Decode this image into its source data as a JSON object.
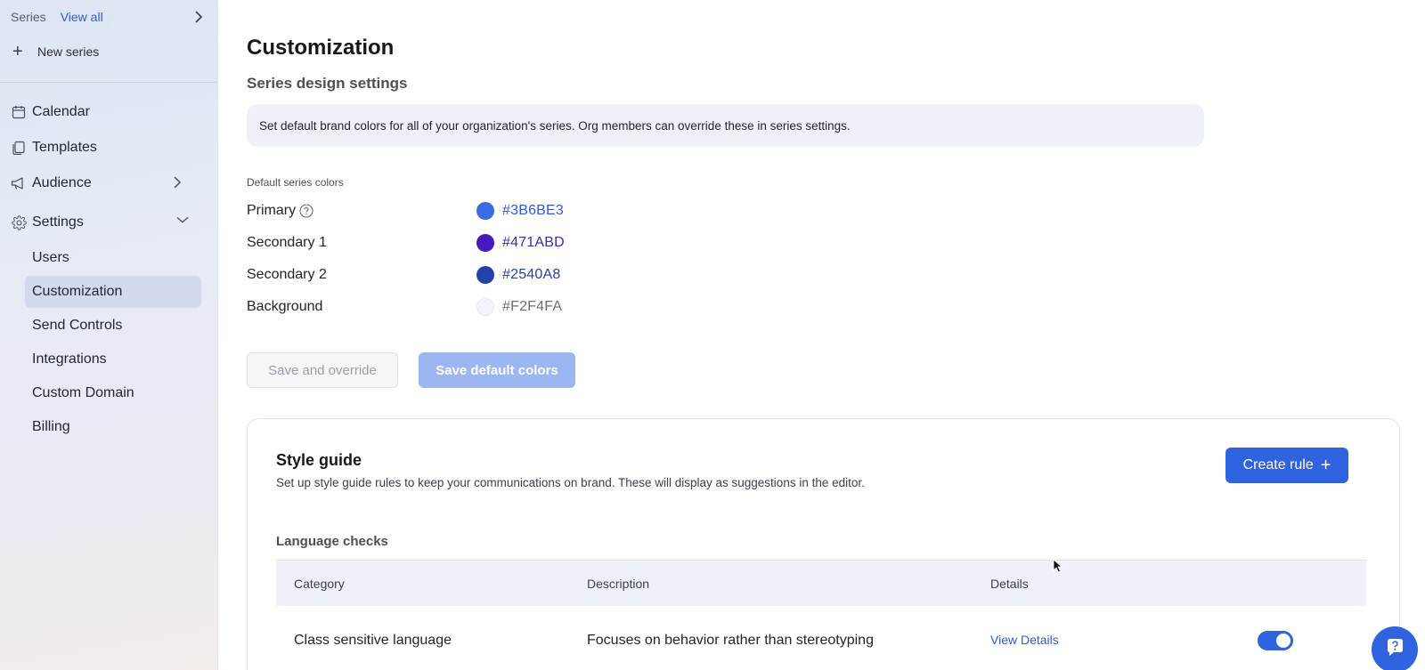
{
  "sidebar": {
    "series_label": "Series",
    "view_all": "View all",
    "new_series": "New series",
    "nav": [
      {
        "label": "Calendar",
        "icon": "calendar-icon"
      },
      {
        "label": "Templates",
        "icon": "templates-icon"
      },
      {
        "label": "Audience",
        "icon": "megaphone-icon"
      },
      {
        "label": "Settings",
        "icon": "gear-icon"
      }
    ],
    "settings_items": [
      {
        "label": "Users"
      },
      {
        "label": "Customization",
        "active": true
      },
      {
        "label": "Send Controls"
      },
      {
        "label": "Integrations"
      },
      {
        "label": "Custom Domain"
      },
      {
        "label": "Billing"
      }
    ]
  },
  "main": {
    "title": "Customization",
    "section_title": "Series design settings",
    "info_text": "Set default brand colors for all of your organization's series. Org members can override these in series settings.",
    "colors_label": "Default series colors",
    "colors": [
      {
        "name": "Primary",
        "hex": "#3B6BE3",
        "swatch": "#3B6BE3",
        "text_color": "#2e5ad8"
      },
      {
        "name": "Secondary 1",
        "hex": "#471ABD",
        "swatch": "#471ABD",
        "text_color": "#3a2db0"
      },
      {
        "name": "Secondary 2",
        "hex": "#2540A8",
        "swatch": "#2540A8",
        "text_color": "#2540A8"
      },
      {
        "name": "Background",
        "hex": "#F2F4FA",
        "swatch": "#F2F4FA",
        "text_color": "#6b6e78"
      }
    ],
    "save_override": "Save and override",
    "save_default": "Save default colors"
  },
  "style_guide": {
    "title": "Style guide",
    "subtitle": "Set up style guide rules to keep your communications on brand. These will display as suggestions in the editor.",
    "create_rule": "Create rule",
    "language_checks": "Language checks",
    "columns": [
      "Category",
      "Description",
      "Details"
    ],
    "rows": [
      {
        "category": "Class sensitive language",
        "description": "Focuses on behavior rather than stereotyping",
        "details": "View Details",
        "enabled": true
      }
    ]
  }
}
